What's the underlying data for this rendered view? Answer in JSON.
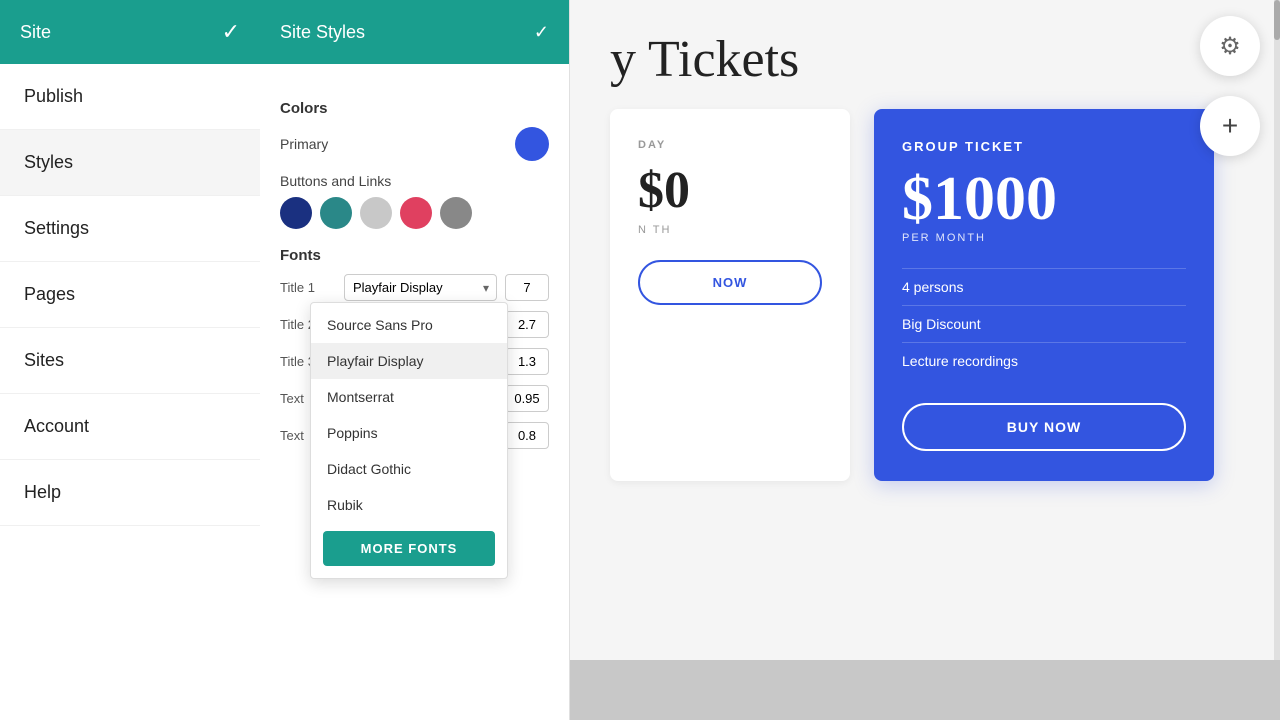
{
  "sidebar": {
    "site_label": "Site",
    "check_mark": "✓",
    "nav_items": [
      {
        "id": "publish",
        "label": "Publish",
        "active": false
      },
      {
        "id": "styles",
        "label": "Styles",
        "active": true
      },
      {
        "id": "settings",
        "label": "Settings",
        "active": false
      },
      {
        "id": "pages",
        "label": "Pages",
        "active": false
      },
      {
        "id": "sites",
        "label": "Sites",
        "active": false
      },
      {
        "id": "account",
        "label": "Account",
        "active": false
      },
      {
        "id": "help",
        "label": "Help",
        "active": false
      }
    ]
  },
  "styles_panel": {
    "title": "Site Styles",
    "check_mark": "✓",
    "colors_section": "Colors",
    "primary_label": "Primary",
    "primary_color": "#3355e0",
    "buttons_links_label": "Buttons and  Links",
    "swatches": [
      {
        "id": "swatch-navy",
        "color": "#1a3080"
      },
      {
        "id": "swatch-teal",
        "color": "#2a8888"
      },
      {
        "id": "swatch-lightgray",
        "color": "#c8c8c8"
      },
      {
        "id": "swatch-pink",
        "color": "#e04060"
      },
      {
        "id": "swatch-gray",
        "color": "#888888"
      }
    ],
    "fonts_section": "Fonts",
    "font_rows": [
      {
        "id": "title1",
        "label": "Title 1",
        "font": "Playfair Display",
        "value": "7"
      },
      {
        "id": "title2",
        "label": "Title 2",
        "font": "...",
        "value": "2.7"
      },
      {
        "id": "title3",
        "label": "Title 3",
        "font": "...",
        "value": "1.3"
      },
      {
        "id": "text1",
        "label": "Text",
        "font": "...",
        "value": "0.95"
      },
      {
        "id": "text2",
        "label": "Text",
        "font": "...",
        "value": "0.8"
      }
    ]
  },
  "font_dropdown": {
    "items": [
      {
        "id": "source-sans-pro",
        "label": "Source Sans Pro",
        "selected": false
      },
      {
        "id": "playfair-display",
        "label": "Playfair Display",
        "selected": true
      },
      {
        "id": "montserrat",
        "label": "Montserrat",
        "selected": false
      },
      {
        "id": "poppins",
        "label": "Poppins",
        "selected": false
      },
      {
        "id": "didact-gothic",
        "label": "Didact Gothic",
        "selected": false
      },
      {
        "id": "rubik",
        "label": "Rubik",
        "selected": false
      }
    ],
    "more_fonts_label": "MORE FONTS"
  },
  "main_content": {
    "page_title": "y Tickets",
    "group_ticket": {
      "type": "GROUP TICKET",
      "currency": "$",
      "price": "1000",
      "period": "PER MONTH",
      "features": [
        "4 persons",
        "Big Discount",
        "Lecture recordings"
      ],
      "buy_label": "BUY NOW"
    },
    "standard_ticket": {
      "type": "DAY",
      "price": "0",
      "period": "N TH",
      "buy_label": "NOW"
    }
  },
  "icons": {
    "gear": "⚙",
    "plus": "+",
    "check": "✓",
    "chevron_down": "▾"
  }
}
